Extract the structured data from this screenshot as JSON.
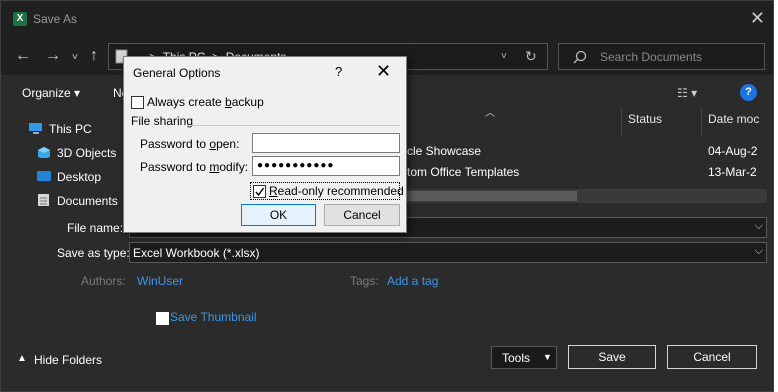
{
  "window": {
    "title": "Save As",
    "app_icon": "excel-icon",
    "close_glyph": "✕"
  },
  "nav": {
    "back": "←",
    "forward": "→",
    "recent": "˅",
    "up": "↑",
    "breadcrumb": [
      "This PC",
      "Documents"
    ],
    "breadcrumb_sep": ">",
    "refresh": "↻",
    "search_placeholder": "Search Documents"
  },
  "toolbar": {
    "organize": "Organize ▾",
    "new_folder": "Ne",
    "view_glyph": "☷ ▾",
    "help": "?"
  },
  "sidebar": {
    "items": [
      {
        "label": "This PC",
        "icon": "pc-icon"
      },
      {
        "label": "3D Objects",
        "icon": "cube-icon"
      },
      {
        "label": "Desktop",
        "icon": "desktop-icon"
      },
      {
        "label": "Documents",
        "icon": "documents-icon"
      }
    ]
  },
  "columns": {
    "status": "Status",
    "date": "Date moc"
  },
  "files": [
    {
      "name": "cle Showcase",
      "date": "04-Aug-2"
    },
    {
      "name": "tom Office Templates",
      "date": "13-Mar-2"
    }
  ],
  "form": {
    "file_name_label": "File name:",
    "file_name_value": "",
    "save_as_type_label": "Save as type:",
    "save_as_type_value": "Excel Workbook (*.xlsx)",
    "authors_label": "Authors:",
    "authors_value": "WinUser",
    "tags_label": "Tags:",
    "tags_value": "Add a tag",
    "save_thumbnail": "Save Thumbnail"
  },
  "footer": {
    "hide_folders": "Hide Folders",
    "tools": "Tools",
    "save": "Save",
    "cancel": "Cancel"
  },
  "general_options": {
    "title": "General Options",
    "help": "?",
    "close": "✕",
    "always_backup": "Always create backup",
    "always_backup_checked": false,
    "file_sharing": "File sharing",
    "password_open_label": "Password to open:",
    "password_open_value": "",
    "password_modify_label": "Password to modify:",
    "password_modify_value": "●●●●●●●●●●●",
    "read_only": "Read-only recommended",
    "read_only_checked": true,
    "ok": "OK",
    "cancel": "Cancel"
  },
  "colors": {
    "dark_bg": "#2b2b2b",
    "title_bg": "#202020",
    "link": "#3c96e6",
    "accent": "#0078d7"
  }
}
